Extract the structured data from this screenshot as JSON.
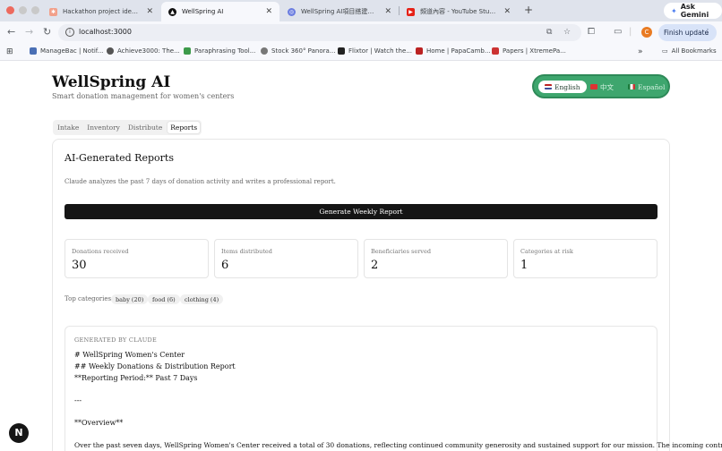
{
  "browser": {
    "tabs": [
      {
        "title": "Hackathon project ideas for ...",
        "icon": "spark-icon"
      },
      {
        "title": "WellSpring AI",
        "icon": "app-icon"
      },
      {
        "title": "WellSpring AI項目搭建指南说...",
        "icon": "ai-icon"
      },
      {
        "title": "頻道內容 - YouTube Studio",
        "icon": "youtube-icon"
      }
    ],
    "ask_gemini": "Ask Gemini",
    "url": "localhost:3000",
    "profile_initial": "C",
    "finish_update": "Finish update",
    "bookmarks": [
      "ManageBac | Notif...",
      "Achieve3000: The...",
      "Paraphrasing Tool...",
      "Stock 360° Panora...",
      "Flixtor | Watch the...",
      "Home | PapaCamb...",
      "Papers | XtremePa..."
    ],
    "all_bookmarks": "All Bookmarks"
  },
  "app": {
    "title": "WellSpring AI",
    "subtitle": "Smart donation management for women's centers",
    "languages": [
      {
        "label": "English",
        "selected": true
      },
      {
        "label": "中文",
        "selected": false
      },
      {
        "label": "Español",
        "selected": false
      }
    ],
    "tabs": [
      "Intake",
      "Inventory",
      "Distribute",
      "Reports"
    ],
    "active_tab": "Reports"
  },
  "reports": {
    "heading": "AI-Generated Reports",
    "description": "Claude analyzes the past 7 days of donation activity and writes a professional report.",
    "generate_button": "Generate Weekly Report",
    "stats": [
      {
        "label": "Donations received",
        "value": "30"
      },
      {
        "label": "Items distributed",
        "value": "6"
      },
      {
        "label": "Beneficiaries served",
        "value": "2"
      },
      {
        "label": "Categories at risk",
        "value": "1"
      }
    ],
    "top_categories_label": "Top categories:",
    "top_categories": [
      "baby (20)",
      "food (6)",
      "clothing (4)"
    ],
    "generated_label": "GENERATED BY CLAUDE",
    "report_lines": [
      "# WellSpring Women's Center",
      "## Weekly Donations & Distribution Report",
      "**Reporting Period:** Past 7 Days",
      "---",
      "**Overview**",
      "Over the past seven days, WellSpring Women's Center received a total of 30 donations, reflecting continued community generosity and sustained support for our mission. The incoming contributions"
    ]
  },
  "fab_label": "N"
}
